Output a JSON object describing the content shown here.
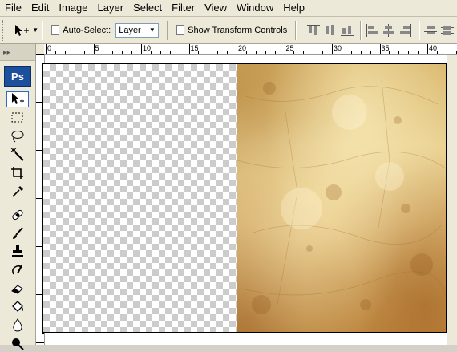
{
  "menu": [
    {
      "id": "file",
      "label": "File"
    },
    {
      "id": "edit",
      "label": "Edit"
    },
    {
      "id": "image",
      "label": "Image"
    },
    {
      "id": "layer",
      "label": "Layer"
    },
    {
      "id": "select",
      "label": "Select"
    },
    {
      "id": "filter",
      "label": "Filter"
    },
    {
      "id": "view",
      "label": "View"
    },
    {
      "id": "window",
      "label": "Window"
    },
    {
      "id": "help",
      "label": "Help"
    }
  ],
  "options": {
    "auto_select_label": "Auto-Select:",
    "auto_select_checked": false,
    "auto_select_value": "Layer",
    "show_transform_label": "Show Transform Controls",
    "show_transform_checked": false
  },
  "toolbox": {
    "logo": "Ps",
    "tools": [
      "move-tool",
      "marquee-tool",
      "lasso-tool",
      "magic-wand-tool",
      "crop-tool",
      "eyedropper-tool",
      "healing-brush-tool",
      "brush-tool",
      "clone-stamp-tool",
      "history-brush-tool",
      "eraser-tool",
      "paint-bucket-tool",
      "blur-tool",
      "dodge-tool"
    ],
    "active_tool": "move-tool"
  },
  "ruler": {
    "labels": [
      "0",
      "5",
      "10",
      "15",
      "20",
      "25",
      "30",
      "35",
      "40"
    ]
  },
  "canvas": {
    "left_half": "transparent",
    "right_half": "parchment-texture"
  }
}
